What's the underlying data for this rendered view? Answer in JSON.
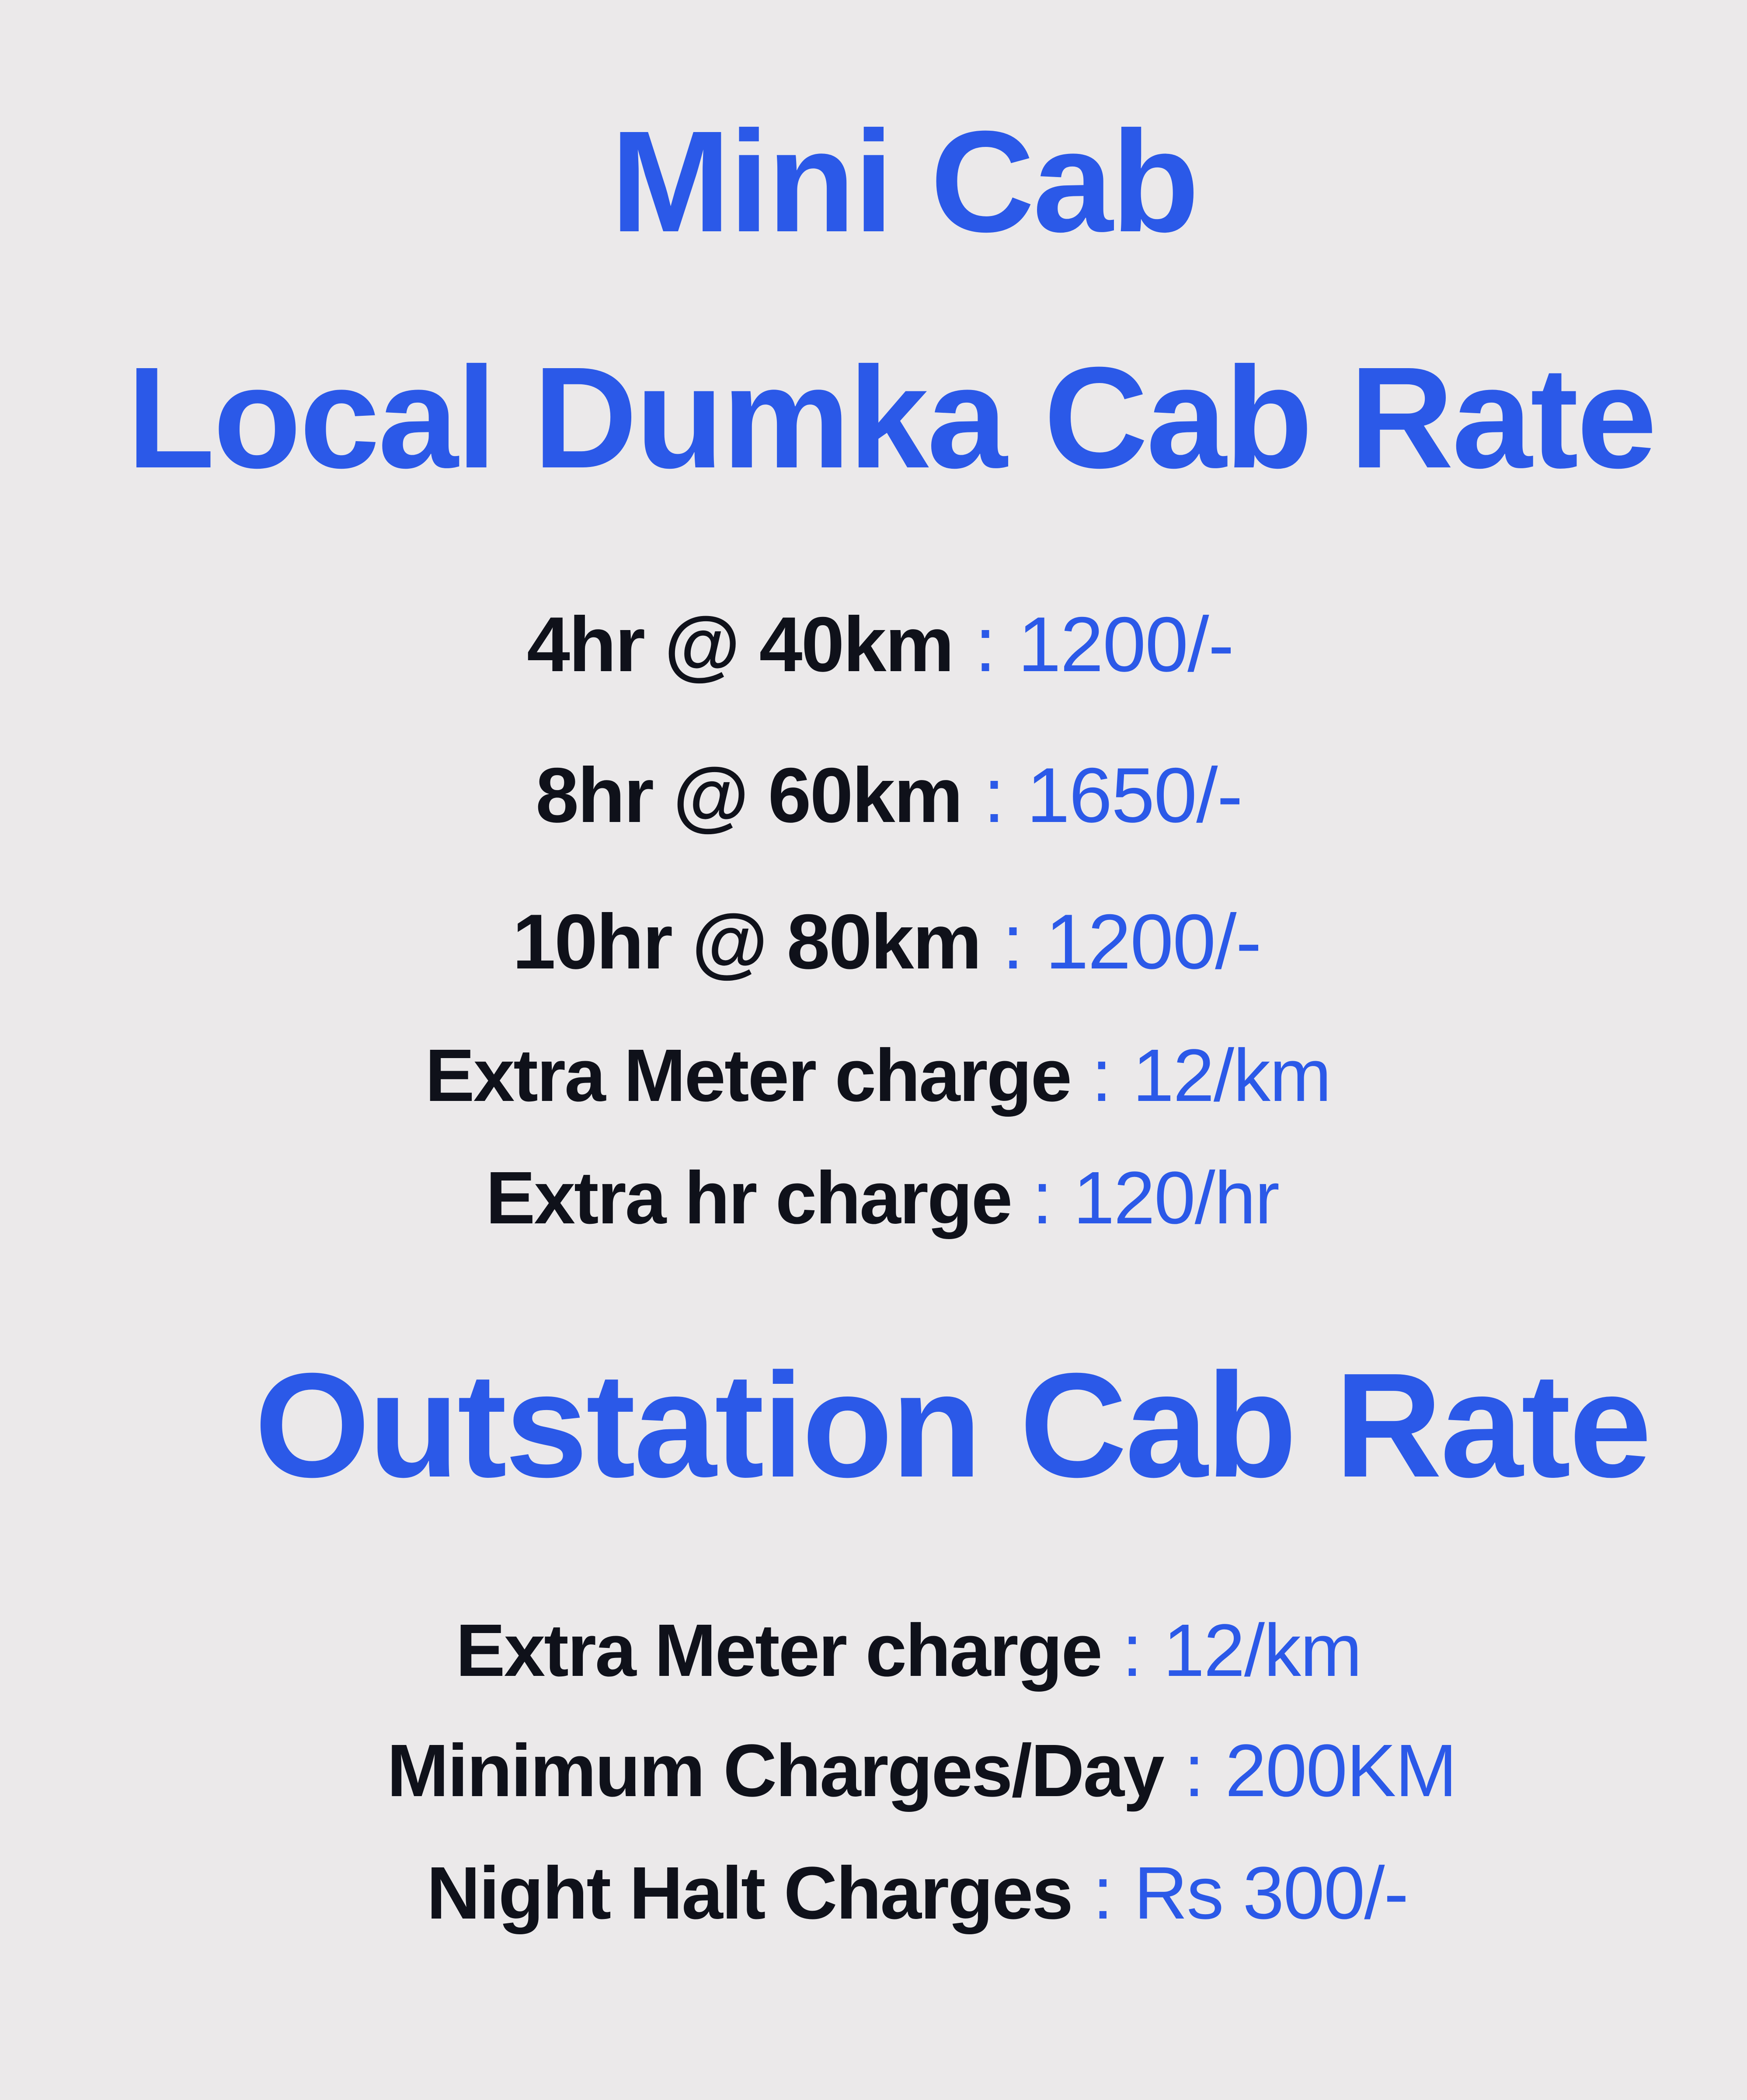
{
  "header": {
    "title": "Mini Cab",
    "local_title": "Local Dumka Cab Rate"
  },
  "local_rates": [
    {
      "label": "4hr @ 40km",
      "separator": " : ",
      "value": "1200/-"
    },
    {
      "label": "8hr @ 60km",
      "separator": " : ",
      "value": "1650/-"
    },
    {
      "label": "10hr @ 80km",
      "separator": " : ",
      "value": "1200/-"
    },
    {
      "label": "Extra Meter charge",
      "separator": " : ",
      "value": "12/km"
    },
    {
      "label": "Extra hr charge",
      "separator": " : ",
      "value": "120/hr"
    }
  ],
  "outstation": {
    "title": "Outstation Cab Rate",
    "rates": [
      {
        "label": "Extra Meter charge",
        "separator": " : ",
        "value": "12/km"
      },
      {
        "label": "Minimum Charges/Day",
        "separator": " : ",
        "value": "200KM"
      },
      {
        "label": "Night Halt Charges",
        "separator": " : ",
        "value": "Rs 300/-"
      }
    ]
  },
  "colors": {
    "accent": "#2b59e8",
    "label": "#0f111a",
    "background": "#ebe9ea"
  }
}
